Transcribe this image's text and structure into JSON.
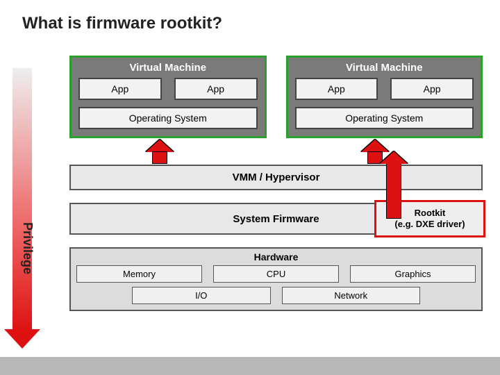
{
  "title": "What is firmware rootkit?",
  "privilege_label": "Privilege",
  "vm": {
    "heading": "Virtual Machine",
    "app_label": "App",
    "os_label": "Operating System"
  },
  "layers": {
    "vmm": "VMM / Hypervisor",
    "firmware": "System Firmware",
    "rootkit_line1": "Rootkit",
    "rootkit_line2": "(e.g. DXE driver)"
  },
  "hardware": {
    "heading": "Hardware",
    "memory": "Memory",
    "cpu": "CPU",
    "graphics": "Graphics",
    "io": "I/O",
    "network": "Network"
  }
}
